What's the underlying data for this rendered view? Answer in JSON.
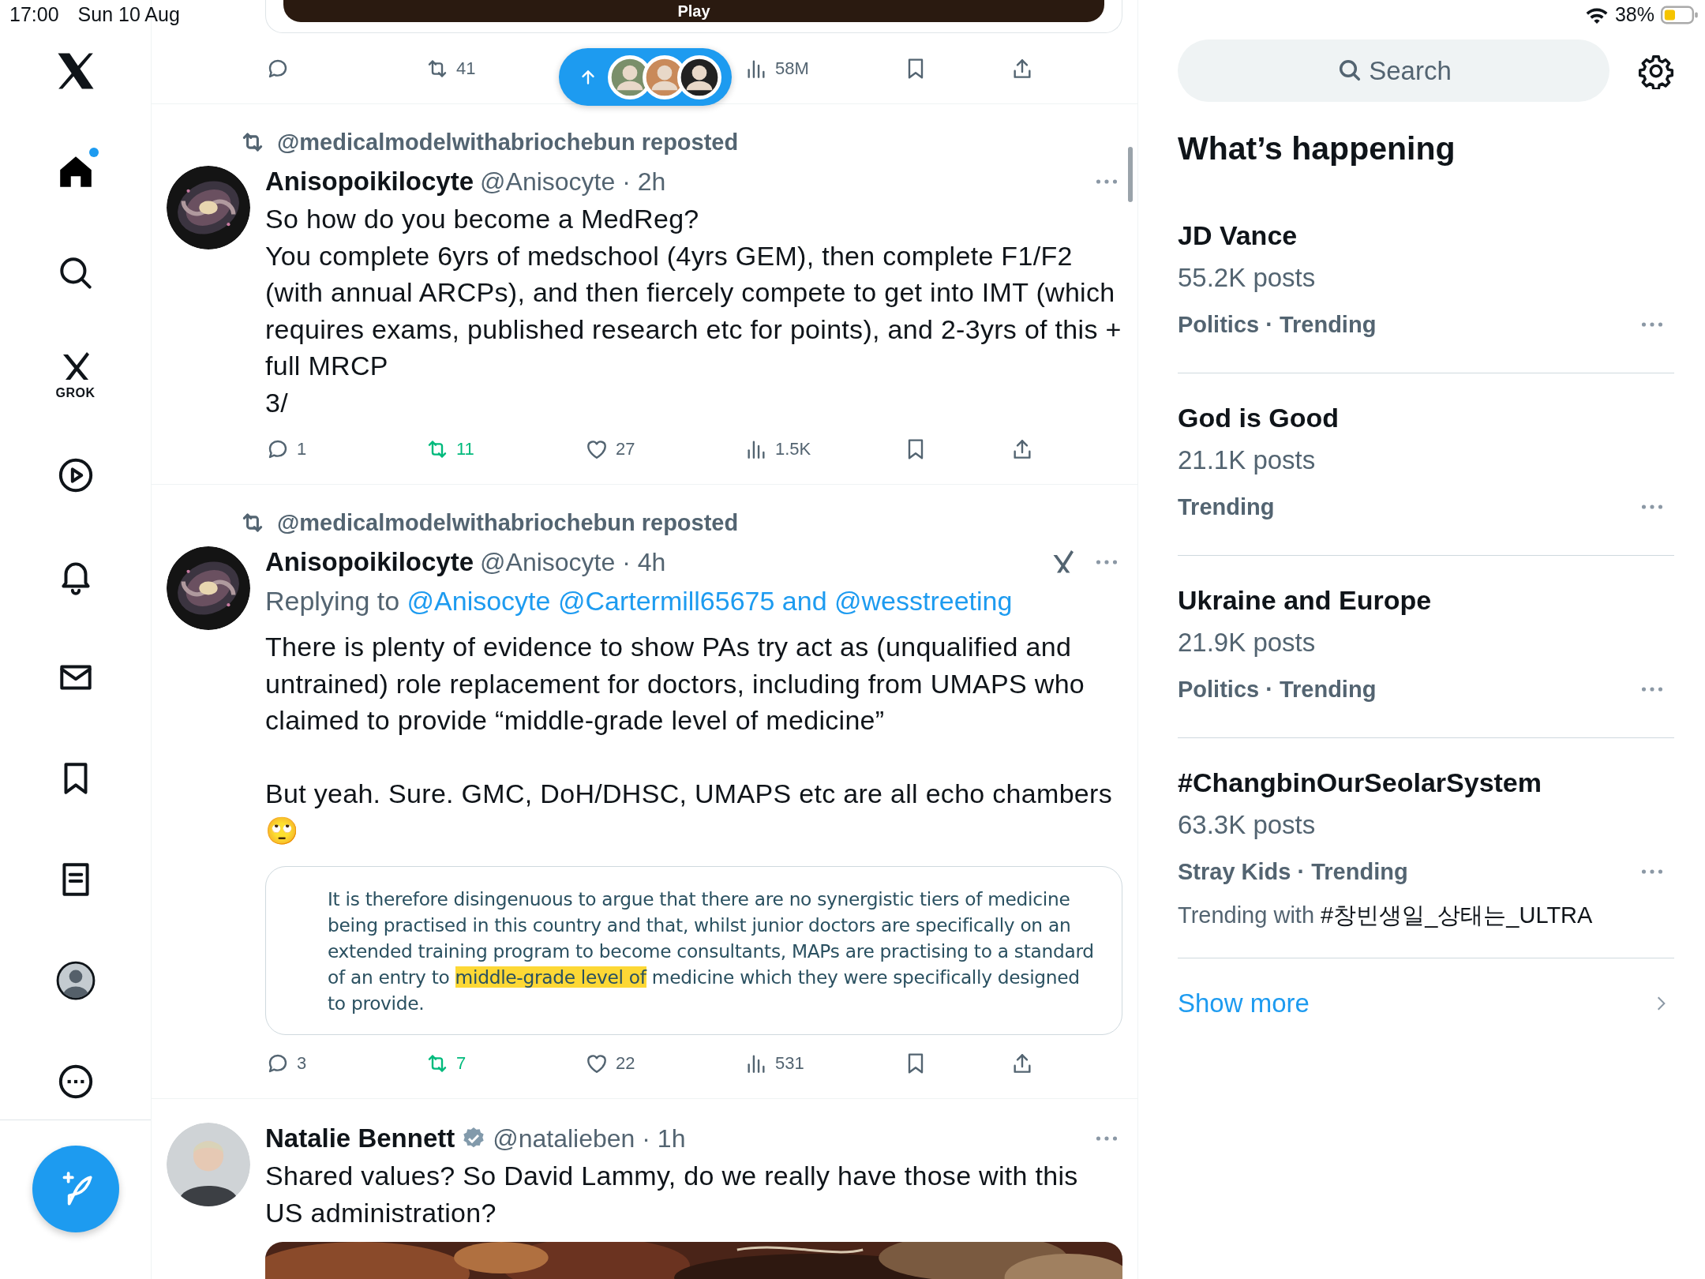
{
  "status_bar": {
    "time": "17:00",
    "date": "Sun 10 Aug",
    "battery": "38%"
  },
  "nav": [
    {
      "selected": false,
      "unread": false
    },
    {
      "selected": true,
      "unread": true
    },
    {
      "selected": false,
      "unread": false
    },
    {
      "label": "GROK",
      "selected": false,
      "unread": false
    },
    {
      "selected": false,
      "unread": false
    },
    {
      "selected": false,
      "unread": false
    },
    {
      "selected": false,
      "unread": false
    },
    {
      "selected": false,
      "unread": false
    },
    {
      "selected": false,
      "unread": false
    },
    {
      "selected": false,
      "unread": false
    },
    {
      "selected": false,
      "unread": false
    }
  ],
  "top_card": {
    "button": "Play",
    "actions": [
      {
        "kind": "reply",
        "active": false
      },
      {
        "kind": "repost",
        "count": "41",
        "active": false
      },
      {
        "kind": "views",
        "count": "58M",
        "active": false
      },
      {
        "kind": "bookmark",
        "active": false
      },
      {
        "kind": "share",
        "active": false
      }
    ]
  },
  "tweets": [
    {
      "reposted_by": "@medicalmodelwithabriochebun reposted",
      "name": "Anisopoikilocyte",
      "verified": false,
      "handle_time": "@Anisocyte · 2h",
      "grok": false,
      "text": "So how do you become a MedReg?\nYou complete 6yrs of medschool (4yrs GEM), then complete F1/F2 (with annual ARCPs), and then fiercely compete to get into IMT (which requires exams, published research etc for points), and 2-3yrs of this + full MRCP\n3/",
      "actions": [
        {
          "kind": "reply",
          "count": "1",
          "active": false
        },
        {
          "kind": "repost",
          "count": "11",
          "active": true
        },
        {
          "kind": "like",
          "count": "27",
          "active": false
        },
        {
          "kind": "views",
          "count": "1.5K",
          "active": false
        },
        {
          "kind": "bookmark",
          "active": false
        },
        {
          "kind": "share",
          "active": false
        }
      ]
    },
    {
      "reposted_by": "@medicalmodelwithabriochebun reposted",
      "name": "Anisopoikilocyte",
      "verified": false,
      "handle_time": "@Anisocyte · 4h",
      "grok": true,
      "replying_label": "Replying to",
      "replying_targets": "@Anisocyte @Cartermill65675 and @wesstreeting",
      "text": "There is plenty of evidence to show PAs try act as (unqualified and untrained) role replacement for doctors, including from UMAPS who claimed to provide “middle-grade level of medicine”\n\nBut yeah. Sure. GMC, DoH/DHSC, UMAPS etc are all echo chambers\n🙄",
      "quote_image": [
        {
          "text": "It is therefore disingenuous to argue that there are no synergistic tiers of medicine being practised in this country and that, whilst junior doctors are specifically on an extended training program to become consultants, MAPs are practising to a standard of an entry to ",
          "highlighted": false
        },
        {
          "text": "middle-grade level of",
          "highlighted": true
        },
        {
          "text": " medicine which they were specifically designed to provide.",
          "highlighted": false
        }
      ],
      "actions": [
        {
          "kind": "reply",
          "count": "3",
          "active": false
        },
        {
          "kind": "repost",
          "count": "7",
          "active": true
        },
        {
          "kind": "like",
          "count": "22",
          "active": false
        },
        {
          "kind": "views",
          "count": "531",
          "active": false
        },
        {
          "kind": "bookmark",
          "active": false
        },
        {
          "kind": "share",
          "active": false
        }
      ]
    },
    {
      "name": "Natalie Bennett",
      "verified": true,
      "handle_time": "@natalieben · 1h",
      "grok": false,
      "text": "Shared values? So David Lammy, do we really have those with this US administration?"
    }
  ],
  "sidebar": {
    "search": {
      "placeholder": "Search"
    },
    "title": "What’s happening",
    "trends": [
      {
        "title": "JD Vance",
        "posts": "55.2K posts",
        "meta": "Politics · Trending"
      },
      {
        "title": "God is Good",
        "posts": "21.1K posts",
        "meta": "Trending"
      },
      {
        "title": "Ukraine and Europe",
        "posts": "21.9K posts",
        "meta": "Politics · Trending"
      },
      {
        "title": "#ChangbinOurSeolarSystem",
        "posts": "63.3K posts",
        "meta": "Stray Kids · Trending",
        "context_label": "Trending with",
        "context_tag": "#창빈생일_상태는_ULTRA"
      }
    ],
    "show_more": "Show more"
  }
}
